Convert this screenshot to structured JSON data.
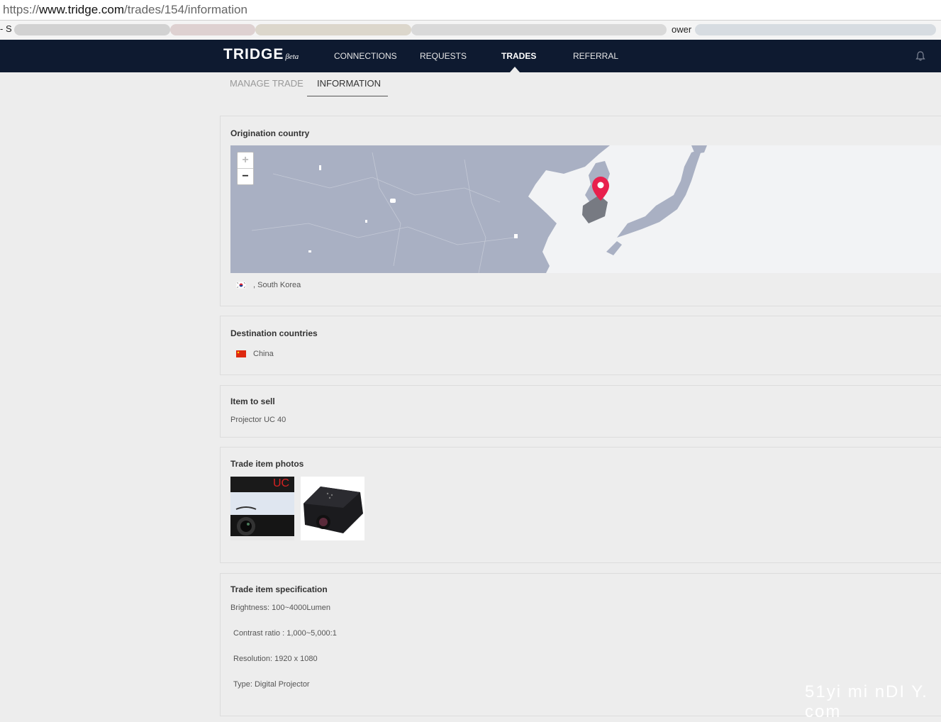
{
  "browser": {
    "url_scheme_prefix": "https://",
    "url_host": "www.tridge.com",
    "url_path": "/trades/154/information",
    "bookmark_left": "- S",
    "bookmark_right": "ower"
  },
  "nav": {
    "logo": "TRIDGE",
    "beta": "βeta",
    "items": [
      "CONNECTIONS",
      "REQUESTS",
      "TRADES",
      "REFERRAL"
    ],
    "active": "TRADES"
  },
  "subtabs": {
    "manage": "MANAGE TRADE",
    "information": "INFORMATION"
  },
  "origination": {
    "title": "Origination country",
    "country_label": ", South Korea",
    "zoom_in": "+",
    "zoom_out": "−"
  },
  "destination": {
    "title": "Destination countries",
    "country_label": "China"
  },
  "item": {
    "title": "Item to sell",
    "value": "Projector UC 40"
  },
  "photos": {
    "title": "Trade item photos",
    "photo1_text": "UC"
  },
  "spec": {
    "title": "Trade item specification",
    "lines": [
      "Brightness: 100~4000Lumen",
      "Contrast ratio : 1,000~5,000:1",
      "Resolution: 1920 x 1080",
      "Type: Digital Projector"
    ]
  },
  "watermark": "51yi mi nDI Y. com",
  "colors": {
    "nav_bg": "#0e1a30",
    "page_bg": "#ededed",
    "map_land": "#a9b0c3",
    "pin": "#e8204d"
  }
}
